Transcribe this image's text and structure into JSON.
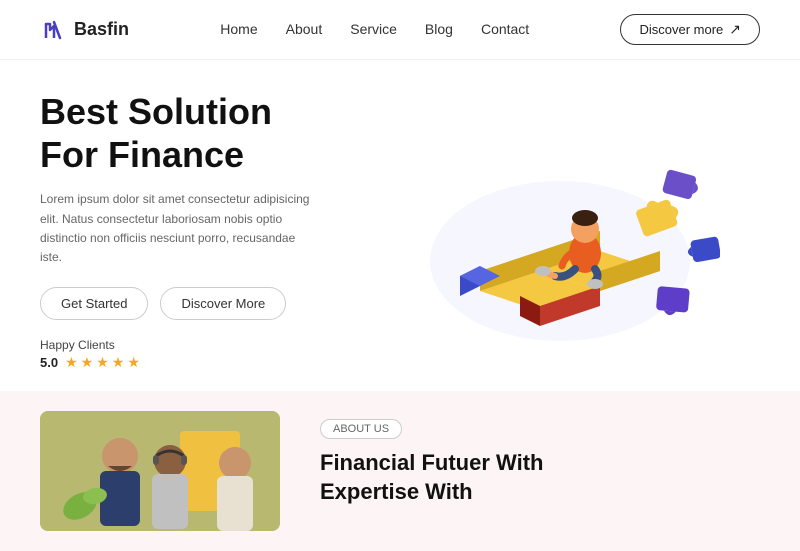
{
  "navbar": {
    "logo_text": "Basfin",
    "nav_items": [
      "Home",
      "About",
      "Service",
      "Blog",
      "Contact"
    ],
    "discover_btn": "Discover more"
  },
  "hero": {
    "title_line1": "Best Solution",
    "title_line2": "For Finance",
    "description": "Lorem ipsum dolor sit amet consectetur adipisicing elit. Natus consectetur laboriosam nobis optio distinctio non officiis nesciunt porro, recusandae iste.",
    "btn_get_started": "Get Started",
    "btn_discover_more": "Discover More",
    "happy_clients_label": "Happy Clients",
    "rating": "5.0",
    "stars_count": 5
  },
  "about": {
    "badge": "ABOUT US",
    "title_line1": "Financial Futuer With",
    "title_line2": "Expertise With"
  }
}
